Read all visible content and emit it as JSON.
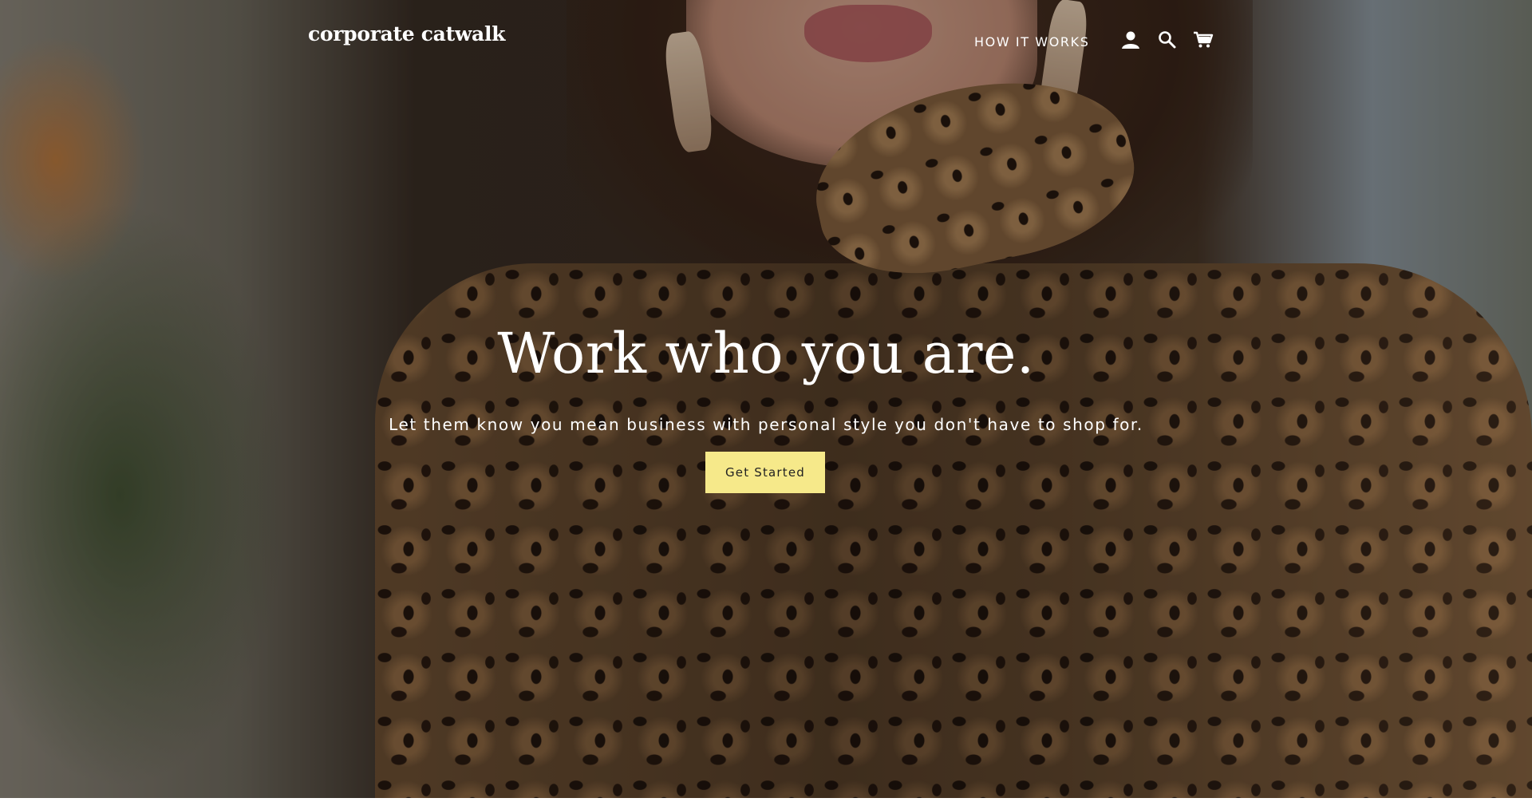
{
  "header": {
    "logo": "corporate catwalk",
    "nav": [
      {
        "label": "HOW IT WORKS"
      }
    ],
    "icons": {
      "account": "account-icon",
      "search": "search-icon",
      "cart": "cart-icon"
    }
  },
  "hero": {
    "title": "Work who you are.",
    "subtitle": "Let them know you mean business with personal style you don't have to shop for.",
    "cta_label": "Get Started",
    "cta_color": "#f6e98a"
  }
}
